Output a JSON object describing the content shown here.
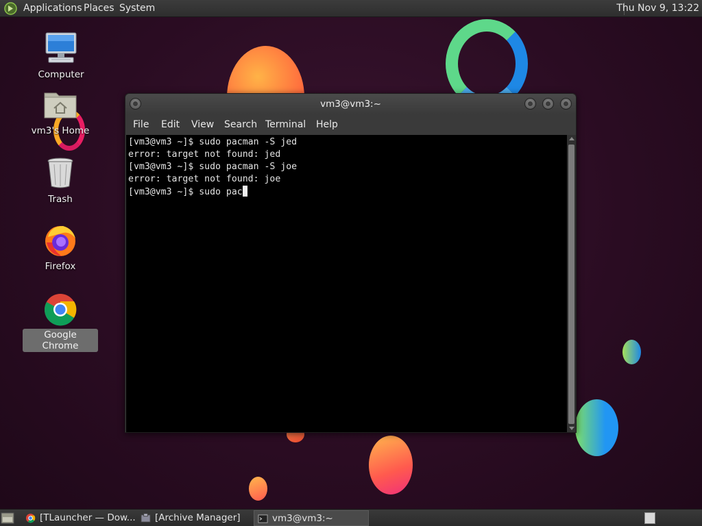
{
  "top_panel": {
    "menus": [
      "Applications",
      "Places",
      "System"
    ],
    "clock": "Thu Nov  9, 13:22"
  },
  "desktop_icons": [
    {
      "label": "Computer",
      "icon": "computer-icon"
    },
    {
      "label": "vm3's Home",
      "icon": "home-folder-icon"
    },
    {
      "label": "Trash",
      "icon": "trash-icon"
    },
    {
      "label": "Firefox",
      "icon": "firefox-icon"
    },
    {
      "label": "Google Chrome",
      "icon": "chrome-icon",
      "selected": true
    }
  ],
  "terminal": {
    "title": "vm3@vm3:~",
    "menu": [
      "File",
      "Edit",
      "View",
      "Search",
      "Terminal",
      "Help"
    ],
    "lines": [
      "[vm3@vm3 ~]$ sudo pacman -S jed",
      "error: target not found: jed",
      "[vm3@vm3 ~]$ sudo pacman -S joe",
      "error: target not found: joe",
      "[vm3@vm3 ~]$ sudo pac"
    ]
  },
  "taskbar": {
    "tasks": [
      {
        "label": "[TLauncher — Dow...",
        "icon": "chrome-icon",
        "active": false
      },
      {
        "label": "[Archive Manager]",
        "icon": "archive-manager-icon",
        "active": false
      },
      {
        "label": "vm3@vm3:~",
        "icon": "terminal-icon",
        "active": true
      }
    ]
  }
}
